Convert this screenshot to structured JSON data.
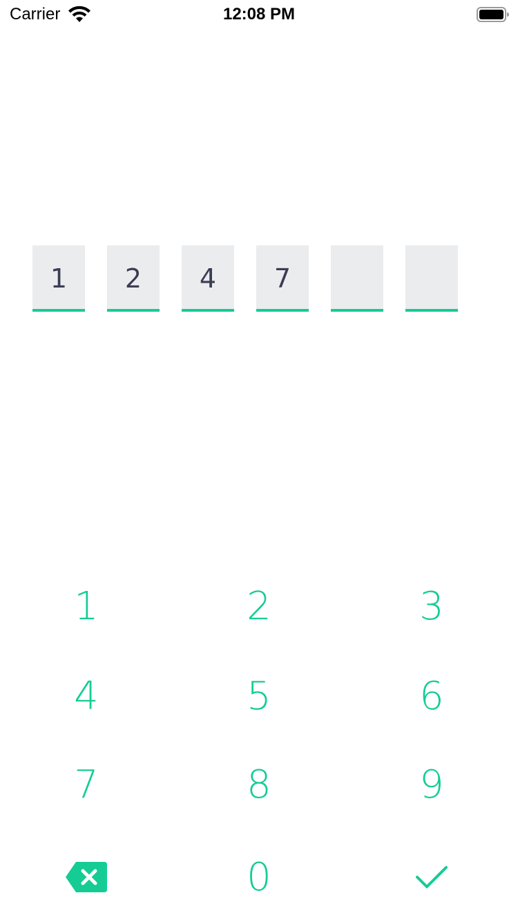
{
  "status_bar": {
    "carrier": "Carrier",
    "time": "12:08 PM",
    "icons": [
      "wifi-icon",
      "battery-icon"
    ]
  },
  "pin": {
    "digits": [
      "1",
      "2",
      "4",
      "7",
      "",
      ""
    ]
  },
  "keypad": {
    "keys": [
      "1",
      "2",
      "3",
      "4",
      "5",
      "6",
      "7",
      "8",
      "9"
    ],
    "zero": "0",
    "delete_icon": "backspace-icon",
    "confirm_icon": "checkmark-icon"
  },
  "colors": {
    "accent": "#15cc95",
    "box_bg": "#ebecee",
    "digit_text": "#3b3d54"
  }
}
